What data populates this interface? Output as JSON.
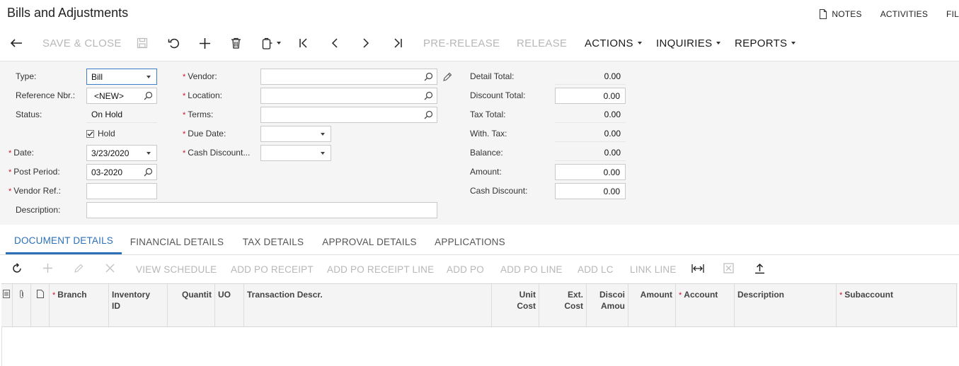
{
  "page": {
    "title": "Bills and Adjustments"
  },
  "top_links": {
    "notes": "NOTES",
    "activities": "ACTIVITIES",
    "files": "FIL"
  },
  "toolbar": {
    "save_close": "SAVE & CLOSE",
    "pre_release": "PRE-RELEASE",
    "release": "RELEASE",
    "actions": "ACTIONS",
    "inquiries": "INQUIRIES",
    "reports": "REPORTS"
  },
  "form": {
    "type": {
      "label": "Type:",
      "value": "Bill"
    },
    "reference_nbr": {
      "label": "Reference Nbr.:",
      "value": "<NEW>"
    },
    "status": {
      "label": "Status:",
      "value": "On Hold"
    },
    "hold": {
      "label": "Hold",
      "checked": true
    },
    "date": {
      "label": "Date:",
      "value": "3/23/2020"
    },
    "post_period": {
      "label": "Post Period:",
      "value": "03-2020"
    },
    "vendor_ref": {
      "label": "Vendor Ref.:",
      "value": ""
    },
    "description": {
      "label": "Description:",
      "value": ""
    },
    "vendor": {
      "label": "Vendor:",
      "value": ""
    },
    "location": {
      "label": "Location:",
      "value": ""
    },
    "terms": {
      "label": "Terms:",
      "value": ""
    },
    "due_date": {
      "label": "Due Date:",
      "value": ""
    },
    "cash_discount_date": {
      "label": "Cash Discount...",
      "value": ""
    },
    "required_marker": "*"
  },
  "totals": {
    "detail_total": {
      "label": "Detail Total:",
      "value": "0.00"
    },
    "discount_total": {
      "label": "Discount Total:",
      "value": "0.00"
    },
    "tax_total": {
      "label": "Tax Total:",
      "value": "0.00"
    },
    "with_tax": {
      "label": "With. Tax:",
      "value": "0.00"
    },
    "balance": {
      "label": "Balance:",
      "value": "0.00"
    },
    "amount": {
      "label": "Amount:",
      "value": "0.00"
    },
    "cash_discount": {
      "label": "Cash Discount:",
      "value": "0.00"
    }
  },
  "tabs": [
    {
      "label": "DOCUMENT DETAILS",
      "active": true
    },
    {
      "label": "FINANCIAL DETAILS",
      "active": false
    },
    {
      "label": "TAX DETAILS",
      "active": false
    },
    {
      "label": "APPROVAL DETAILS",
      "active": false
    },
    {
      "label": "APPLICATIONS",
      "active": false
    }
  ],
  "grid_toolbar": {
    "view_schedule": "VIEW SCHEDULE",
    "add_po_receipt": "ADD PO RECEIPT",
    "add_po_receipt_line": "ADD PO RECEIPT LINE",
    "add_po": "ADD PO",
    "add_po_line": "ADD PO LINE",
    "add_lc": "ADD LC",
    "link_line": "LINK LINE"
  },
  "grid": {
    "columns": {
      "branch": "Branch",
      "inventory_id_1": "Inventory",
      "inventory_id_2": "ID",
      "quantity": "Quantit",
      "uom": "UO",
      "transaction_descr": "Transaction Descr.",
      "unit_cost_1": "Unit",
      "unit_cost_2": "Cost",
      "ext_cost_1": "Ext.",
      "ext_cost_2": "Cost",
      "discount_amount_1": "Discoi",
      "discount_amount_2": "Amou",
      "amount": "Amount",
      "account": "Account",
      "description": "Description",
      "subaccount": "Subaccount"
    }
  },
  "colors": {
    "accent": "#2a6fb8",
    "required": "#c8102e",
    "disabled": "#b7b7b7"
  }
}
